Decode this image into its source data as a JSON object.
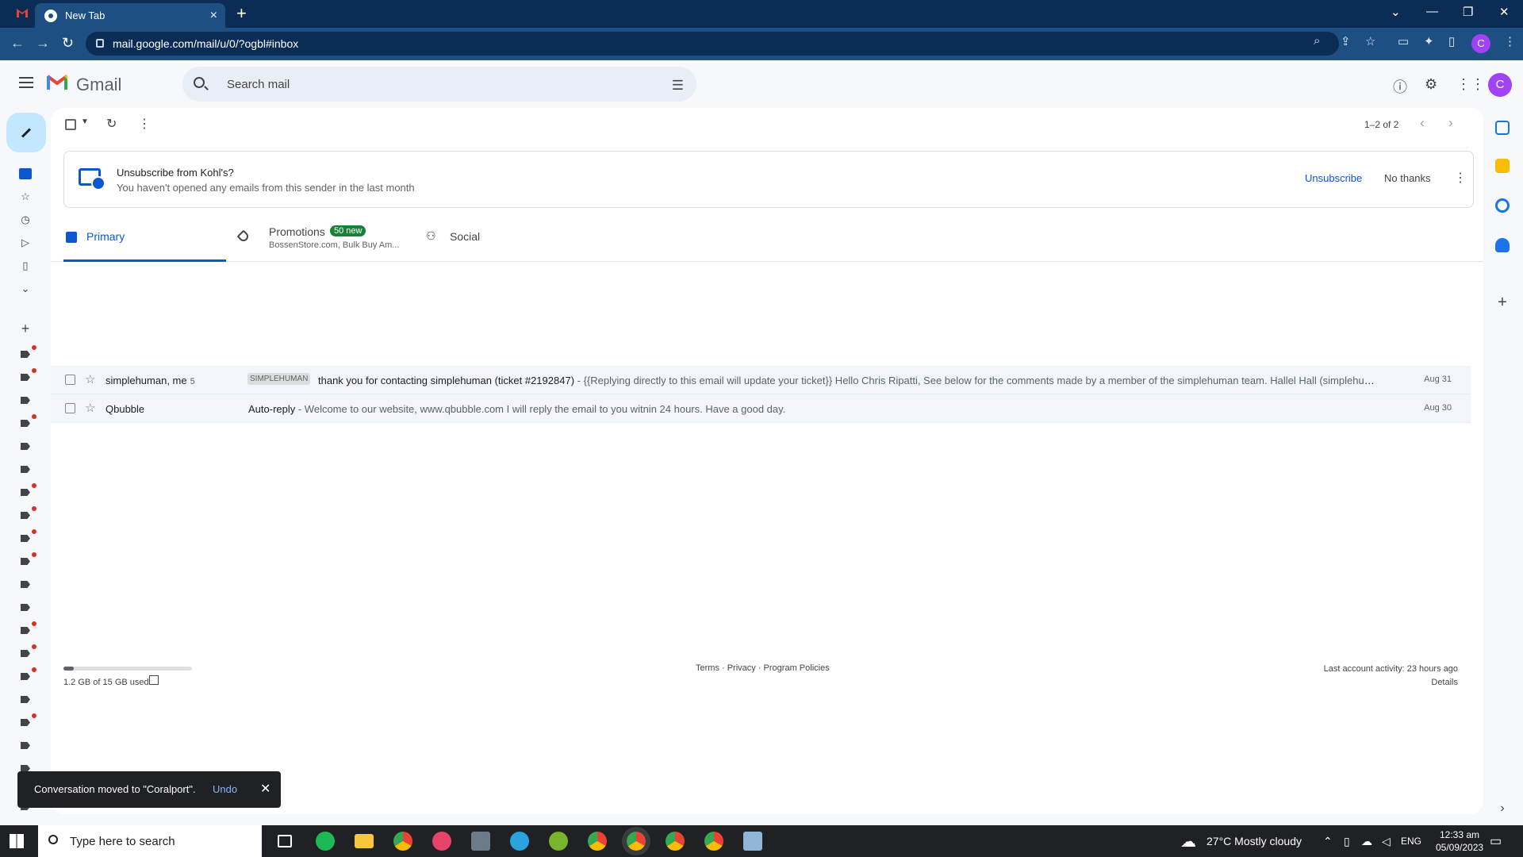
{
  "browser": {
    "tab_title": "New Tab",
    "url": "mail.google.com/mail/u/0/?ogbl#inbox",
    "profile_initial": "C"
  },
  "header": {
    "app_name": "Gmail",
    "search_placeholder": "Search mail",
    "avatar_initial": "C"
  },
  "toolbar": {
    "page_count": "1–2 of 2"
  },
  "banner": {
    "title": "Unsubscribe from Kohl's?",
    "subtitle": "You haven't opened any emails from this sender in the last month",
    "unsubscribe_label": "Unsubscribe",
    "no_thanks_label": "No thanks"
  },
  "tabs": {
    "primary": "Primary",
    "promotions": "Promotions",
    "promotions_badge": "50 new",
    "promotions_sub": "BossenStore.com, Bulk Buy Am...",
    "social": "Social"
  },
  "emails": [
    {
      "from": "simplehuman, me",
      "count": "5",
      "label": "SIMPLEHUMAN",
      "subject": "thank you for contacting simplehuman (ticket #2192847)",
      "snippet": " - {{Replying directly to this email will update your ticket}} Hello Chris Ripatti, See below for the comments made by a member of the simplehuman team. Hallel Hall (simplehuman) A...",
      "date": "Aug 31"
    },
    {
      "from": "Qbubble",
      "count": "",
      "label": "",
      "subject": "Auto-reply",
      "snippet": " - Welcome to our website, www.qbubble.com I will reply the email to you witnin 24 hours. Have a good day.",
      "date": "Aug 30"
    }
  ],
  "footer": {
    "storage_text": "1.2 GB of 15 GB used",
    "storage_used_fraction": 0.08,
    "links": "Terms · Privacy · Program Policies",
    "activity": "Last account activity: 23 hours ago",
    "details": "Details"
  },
  "toast": {
    "message": "Conversation moved to \"Coralport\".",
    "undo": "Undo"
  },
  "taskbar": {
    "search_placeholder": "Type here to search",
    "weather": "27°C  Mostly cloudy",
    "language": "ENG",
    "time": "12:33 am",
    "date": "05/09/2023"
  },
  "colors": {
    "chrome_dark": "#0b2d55",
    "chrome_mid": "#1d4f82",
    "accent_blue": "#0b57d0",
    "promo_green": "#188038",
    "label_dot_red": "#d93025"
  }
}
